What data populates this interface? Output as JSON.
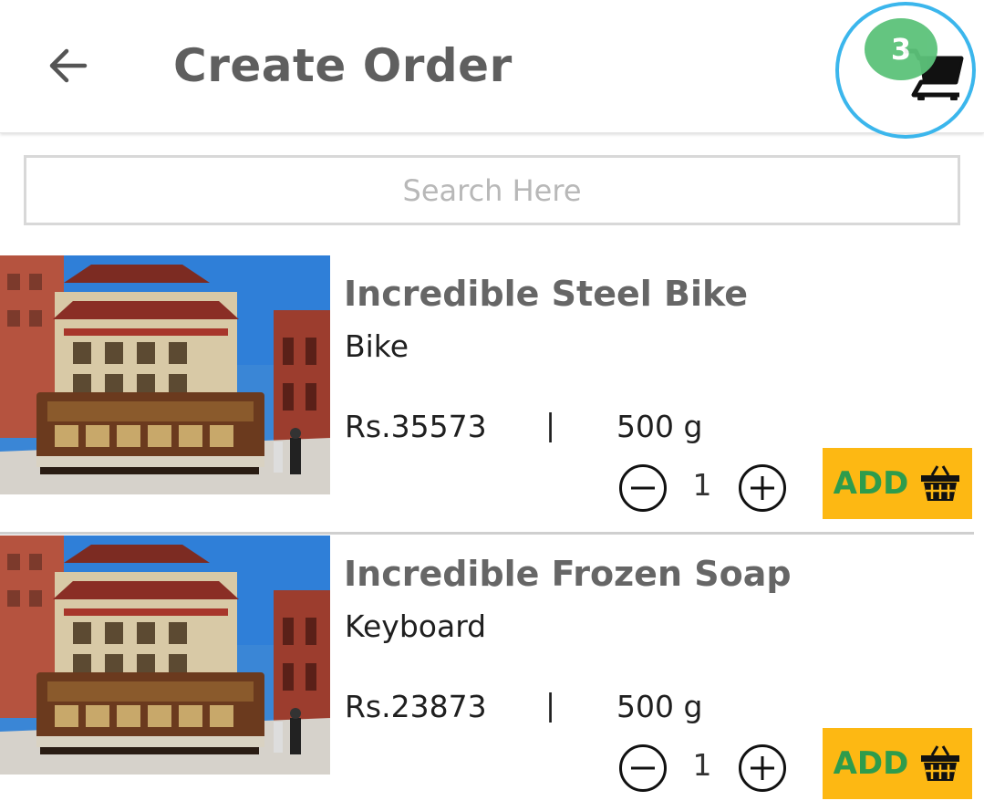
{
  "header": {
    "title": "Create Order",
    "back_icon": "arrow-left-icon",
    "cart_icon": "cart-icon",
    "cart_count": "3",
    "cart_badge_color": "#5cc27a",
    "highlight_ring_color": "#3bb6ec"
  },
  "search": {
    "placeholder": "Search Here",
    "value": ""
  },
  "products": [
    {
      "name": "Incredible Steel Bike",
      "category": "Bike",
      "price": "Rs.35573",
      "separator": "|",
      "weight": "500 g",
      "quantity": "1",
      "add_label": "ADD",
      "add_icon": "basket-icon"
    },
    {
      "name": "Incredible Frozen Soap",
      "category": "Keyboard",
      "price": "Rs.23873",
      "separator": "|",
      "weight": "500 g",
      "quantity": "1",
      "add_label": "ADD",
      "add_icon": "basket-icon"
    }
  ],
  "colors": {
    "add_button_bg": "#fdb813",
    "add_label": "#2e9c4c",
    "title_text": "#5f5f5f"
  }
}
